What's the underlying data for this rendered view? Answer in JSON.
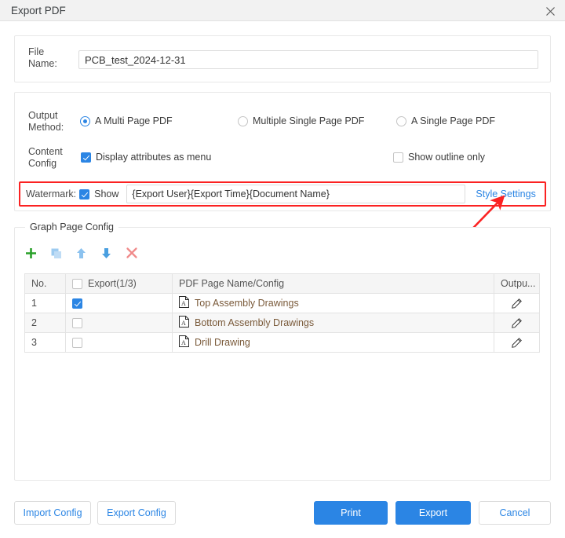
{
  "window": {
    "title": "Export PDF",
    "close_icon": "close-icon"
  },
  "file_name": {
    "label": "File Name:",
    "value": "PCB_test_2024-12-31",
    "placeholder": "File Name"
  },
  "output_method": {
    "label": "Output Method:",
    "options": [
      {
        "label": "A Multi Page PDF",
        "checked": true
      },
      {
        "label": "Multiple Single Page PDF",
        "checked": false
      },
      {
        "label": "A Single Page PDF",
        "checked": false
      }
    ]
  },
  "content_config": {
    "label": "Content Config",
    "options": [
      {
        "label": "Display attributes as menu",
        "checked": true
      },
      {
        "label": "Show outline only",
        "checked": false
      }
    ]
  },
  "watermark": {
    "label": "Watermark:",
    "show_label": "Show",
    "show_checked": true,
    "value": "{Export User}{Export Time}{Document Name}",
    "placeholder": "{Export User}{Export Time}{Document Name}",
    "style_settings_link": "Style Settings",
    "highlight_color": "#fb2222"
  },
  "graph_page_config": {
    "legend": "Graph Page Config",
    "toolbar": [
      {
        "name": "add-icon",
        "color": "#2aa02a"
      },
      {
        "name": "duplicate-icon",
        "color": "#9dcbf0"
      },
      {
        "name": "move-up-icon",
        "color": "#8cc2ef"
      },
      {
        "name": "move-down-icon",
        "color": "#4a9fe0"
      },
      {
        "name": "delete-icon",
        "color": "#f08a8a"
      }
    ],
    "table": {
      "columns": [
        "No.",
        "Export(1/3)",
        "PDF Page Name/Config",
        "Outpu..."
      ],
      "header_checkbox_checked": false,
      "rows": [
        {
          "no": "1",
          "export_checked": true,
          "name": "Top Assembly Drawings",
          "output_icon": "edit-pencil-icon"
        },
        {
          "no": "2",
          "export_checked": false,
          "name": "Bottom Assembly Drawings",
          "output_icon": "edit-pencil-icon"
        },
        {
          "no": "3",
          "export_checked": false,
          "name": "Drill Drawing",
          "output_icon": "edit-pencil-icon"
        }
      ]
    }
  },
  "footer": {
    "import_config": "Import Config",
    "export_config": "Export Config",
    "print": "Print",
    "export": "Export",
    "cancel": "Cancel"
  },
  "colors": {
    "accent": "#2b85e4",
    "annotation": "#fb2222",
    "panel_border": "#e8e8e8"
  }
}
